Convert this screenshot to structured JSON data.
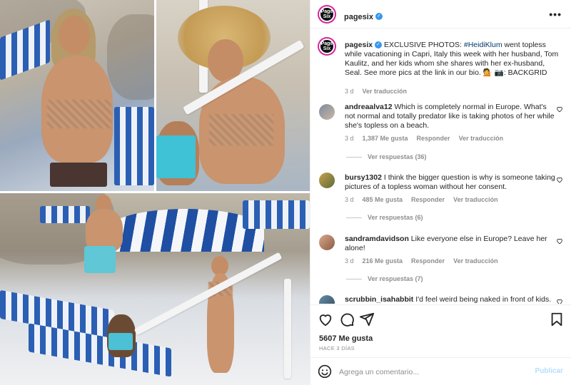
{
  "post": {
    "account": "pagesix",
    "avatar_text": "Page Six",
    "verified": true,
    "caption": {
      "username": "pagesix",
      "text_before_tag": " EXCLUSIVE PHOTOS: ",
      "tag": "#HeidiKlum",
      "text_after_tag": " went topless while vacationing in Capri, Italy this week with her husband, Tom Kaulitz, and her kids whom she shares with her ex-husband, Seal. See more pics at the link in our bio. 💁 📷: BACKGRID",
      "age": "3 d",
      "translate": "Ver traducción"
    }
  },
  "comments": [
    {
      "username": "andreaalva12",
      "text": "Which is completely normal in Europe. What's not normal and totally predator like is taking photos of her while she's topless on a beach.",
      "age": "3 d",
      "likes": "1,387 Me gusta",
      "reply": "Responder",
      "translate": "Ver traducción",
      "view_replies": "Ver respuestas (36)"
    },
    {
      "username": "bursy1302",
      "text": "I think the bigger question is why is someone taking pictures of a topless woman without her consent.",
      "age": "3 d",
      "likes": "485 Me gusta",
      "reply": "Responder",
      "translate": "Ver traducción",
      "view_replies": "Ver respuestas (6)"
    },
    {
      "username": "sandramdavidson",
      "text": "Like everyone else in Europe? Leave her alone!",
      "age": "3 d",
      "likes": "216 Me gusta",
      "reply": "Responder",
      "translate": "Ver traducción",
      "view_replies": "Ver respuestas (7)"
    },
    {
      "username": "scrubbin_isahabbit",
      "text": "I'd feel weird being naked in front of kids."
    }
  ],
  "footer": {
    "likes_count": "5607 Me gusta",
    "time_ago": "HACE 3 DÍAS",
    "comment_placeholder": "Agrega un comentario...",
    "publish_label": "Publicar"
  },
  "colors": {
    "link": "#00376b",
    "verified": "#3897f0",
    "publish_disabled": "#b2dffc",
    "muted": "#8e8e8e"
  },
  "icons": [
    "more-options-icon",
    "verified-badge-icon",
    "heart-icon",
    "comment-icon",
    "share-icon",
    "bookmark-icon",
    "emoji-icon"
  ]
}
